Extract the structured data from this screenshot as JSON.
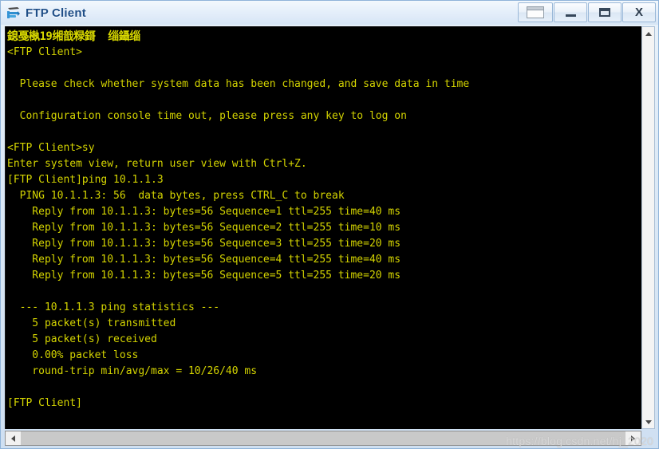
{
  "window": {
    "title": "FTP Client",
    "icon": "ftp-device-icon",
    "buttons": [
      {
        "name": "restore-window-button",
        "glyph": "restore-icon",
        "label": ""
      },
      {
        "name": "minimize-window-button",
        "glyph": "minimize-icon",
        "label": ""
      },
      {
        "name": "maximize-window-button",
        "glyph": "maximize-icon",
        "label": ""
      },
      {
        "name": "close-window-button",
        "glyph": "close-icon",
        "label": "X"
      }
    ]
  },
  "theme": {
    "console_background": "#000000",
    "console_text": "#d4d400",
    "title_text": "#1f4e87",
    "window_frame": "#8fb3d9"
  },
  "console": {
    "lines": [
      {
        "text": "鎴戞槸19缃戠粶鎶  缁鑷缁",
        "style": "cjk"
      },
      {
        "text": "<FTP Client>",
        "style": "normal"
      },
      {
        "text": "",
        "style": "blank"
      },
      {
        "text": "  Please check whether system data has been changed, and save data in time",
        "style": "normal"
      },
      {
        "text": "",
        "style": "blank"
      },
      {
        "text": "  Configuration console time out, please press any key to log on",
        "style": "normal"
      },
      {
        "text": "",
        "style": "blank"
      },
      {
        "text": "<FTP Client>sy",
        "style": "normal"
      },
      {
        "text": "Enter system view, return user view with Ctrl+Z.",
        "style": "normal"
      },
      {
        "text": "[FTP Client]ping 10.1.1.3",
        "style": "normal"
      },
      {
        "text": "  PING 10.1.1.3: 56  data bytes, press CTRL_C to break",
        "style": "normal"
      },
      {
        "text": "    Reply from 10.1.1.3: bytes=56 Sequence=1 ttl=255 time=40 ms",
        "style": "normal"
      },
      {
        "text": "    Reply from 10.1.1.3: bytes=56 Sequence=2 ttl=255 time=10 ms",
        "style": "normal"
      },
      {
        "text": "    Reply from 10.1.1.3: bytes=56 Sequence=3 ttl=255 time=20 ms",
        "style": "normal"
      },
      {
        "text": "    Reply from 10.1.1.3: bytes=56 Sequence=4 ttl=255 time=40 ms",
        "style": "normal"
      },
      {
        "text": "    Reply from 10.1.1.3: bytes=56 Sequence=5 ttl=255 time=20 ms",
        "style": "normal"
      },
      {
        "text": "",
        "style": "blank"
      },
      {
        "text": "  --- 10.1.1.3 ping statistics ---",
        "style": "normal"
      },
      {
        "text": "    5 packet(s) transmitted",
        "style": "normal"
      },
      {
        "text": "    5 packet(s) received",
        "style": "normal"
      },
      {
        "text": "    0.00% packet loss",
        "style": "normal"
      },
      {
        "text": "    round-trip min/avg/max = 10/26/40 ms",
        "style": "normal"
      },
      {
        "text": "",
        "style": "blank"
      },
      {
        "text": "[FTP Client]",
        "style": "normal"
      }
    ]
  },
  "ping_result": {
    "target": "10.1.1.3",
    "payload_bytes": 56,
    "ttl": 255,
    "replies": [
      {
        "sequence": 1,
        "time_ms": 40
      },
      {
        "sequence": 2,
        "time_ms": 10
      },
      {
        "sequence": 3,
        "time_ms": 20
      },
      {
        "sequence": 4,
        "time_ms": 40
      },
      {
        "sequence": 5,
        "time_ms": 20
      }
    ],
    "transmitted": 5,
    "received": 5,
    "packet_loss": "0.00%",
    "min_ms": 10,
    "avg_ms": 26,
    "max_ms": 40
  },
  "scrollbars": {
    "vertical": {
      "up_arrow": "chevron-up-icon",
      "down_arrow": "chevron-down-icon"
    },
    "horizontal": {
      "left_arrow": "chevron-left-icon",
      "right_arrow": "chevron-right-icon"
    }
  },
  "watermark": {
    "text": "https://blog.csdn.net/hj_2020"
  }
}
